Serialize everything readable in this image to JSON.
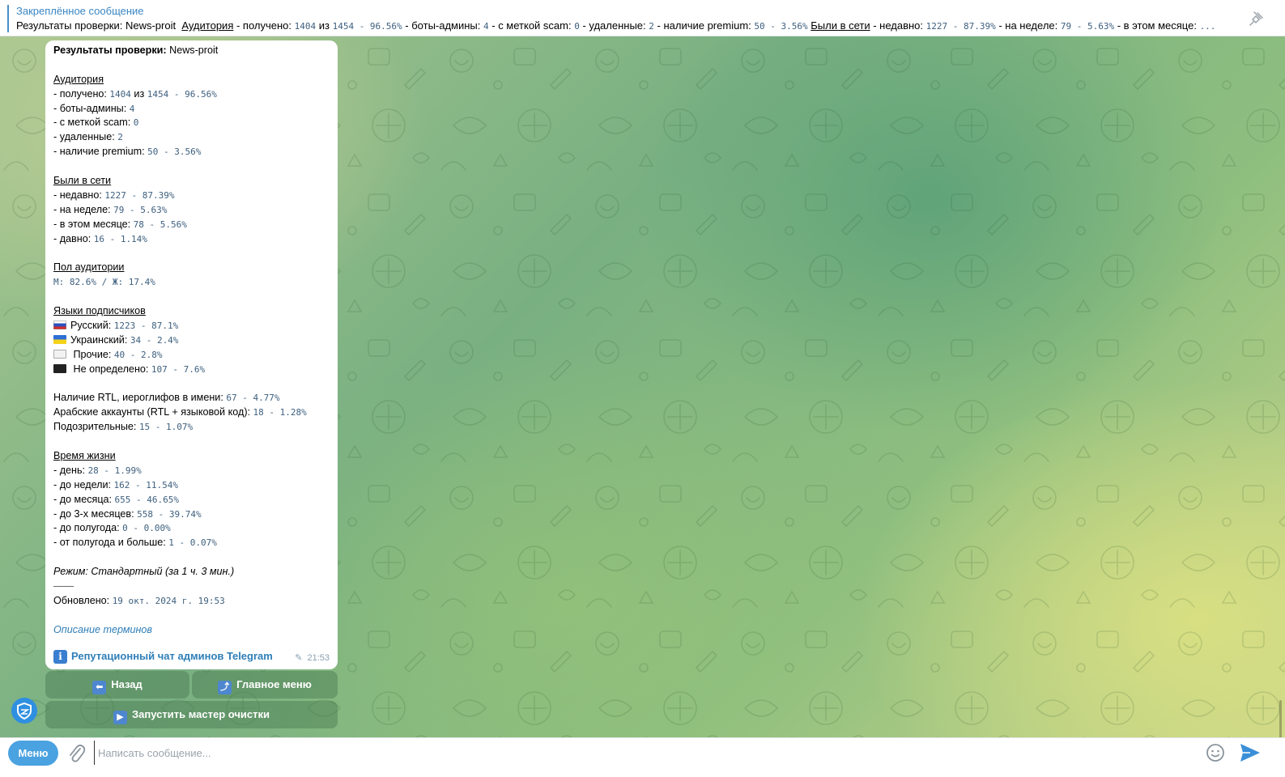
{
  "pinned": {
    "title": "Закреплённое сообщение",
    "prefix": "Результаты проверки: News-proit",
    "audience_label": "Аудитория",
    "audience_text": " - получено: ",
    "audience_v1": "1404",
    "of_text": " из ",
    "audience_v2": "1454 - 96.56%",
    "bots_text": " - боты-админы: ",
    "bots_v": "4",
    "scam_text": " - с меткой scam: ",
    "scam_v": "0",
    "deleted_text": " - удаленные: ",
    "deleted_v": "2",
    "premium_text": " - наличие premium: ",
    "premium_v": "50 - 3.56%",
    "online_label": "Были в сети",
    "recent_text": " - недавно: ",
    "recent_v": "1227 - 87.39%",
    "week_text": " - на неделе: ",
    "week_v": "79 - 5.63%",
    "month_text": " - в этом месяце: ",
    "ellipsis": "..."
  },
  "message": {
    "header_label": "Результаты проверки:",
    "header_value": "News-proit",
    "audience_title": "Аудитория",
    "audience": [
      {
        "label": "- получено: ",
        "v1": "1404",
        "mid": " из ",
        "v2": "1454 - 96.56%"
      },
      {
        "label": "- боты-админы: ",
        "v1": "4"
      },
      {
        "label": "- с меткой scam: ",
        "v1": "0"
      },
      {
        "label": "- удаленные: ",
        "v1": "2"
      },
      {
        "label": "- наличие premium: ",
        "v1": "50 - 3.56%"
      }
    ],
    "online_title": "Были в сети",
    "online": [
      {
        "label": "- недавно: ",
        "v1": "1227 - 87.39%"
      },
      {
        "label": "- на неделе: ",
        "v1": "79 - 5.63%"
      },
      {
        "label": "- в этом месяце: ",
        "v1": "78 - 5.56%"
      },
      {
        "label": "- давно: ",
        "v1": "16 - 1.14%"
      }
    ],
    "gender_title": "Пол аудитории",
    "gender_value": "М: 82.6% / Ж: 17.4%",
    "lang_title": "Языки подписчиков",
    "langs": [
      {
        "flag": "ru",
        "label": "Русский: ",
        "v1": "1223 - 87.1%"
      },
      {
        "flag": "ua",
        "label": "Украинский: ",
        "v1": "34 - 2.4%"
      },
      {
        "flag": "white",
        "label": " Прочие: ",
        "v1": "40 - 2.8%"
      },
      {
        "flag": "black",
        "label": " Не определено: ",
        "v1": "107 - 7.6%"
      }
    ],
    "rtl_label": "Наличие RTL, иероглифов в имени: ",
    "rtl_v": "67 - 4.77%",
    "arab_label": "Арабские аккаунты (RTL + языковой код): ",
    "arab_v": "18 - 1.28%",
    "susp_label": "Подозрительные: ",
    "susp_v": "15 - 1.07%",
    "life_title": "Время жизни",
    "life": [
      {
        "label": "- день: ",
        "v1": "28 - 1.99%"
      },
      {
        "label": "- до недели: ",
        "v1": "162 - 11.54%"
      },
      {
        "label": "- до месяца: ",
        "v1": "655 - 46.65%"
      },
      {
        "label": "- до 3-х месяцев: ",
        "v1": "558 - 39.74%"
      },
      {
        "label": "- до полугода: ",
        "v1": "0 - 0.00%"
      },
      {
        "label": "- от полугода и больше: ",
        "v1": "1 - 0.07%"
      }
    ],
    "mode_text": "Режим: Стандартный (за 1 ч. 3 мин.)",
    "separator": "——",
    "updated_label": "Обновлено: ",
    "updated_value": "19 окт. 2024 г. 19:53",
    "terms_link": "Описание терминов",
    "reputation_link": "Репутационный чат админов Telegram",
    "time": "21:53"
  },
  "keyboard": {
    "back": "Назад",
    "main_menu": "Главное меню",
    "cleanup": "Запустить мастер очистки"
  },
  "composer": {
    "menu_label": "Меню",
    "placeholder": "Написать сообщение..."
  },
  "colors": {
    "accent": "#3a86c4",
    "mono_value": "#3d5f7e",
    "menu_button": "#4aa2e0"
  }
}
